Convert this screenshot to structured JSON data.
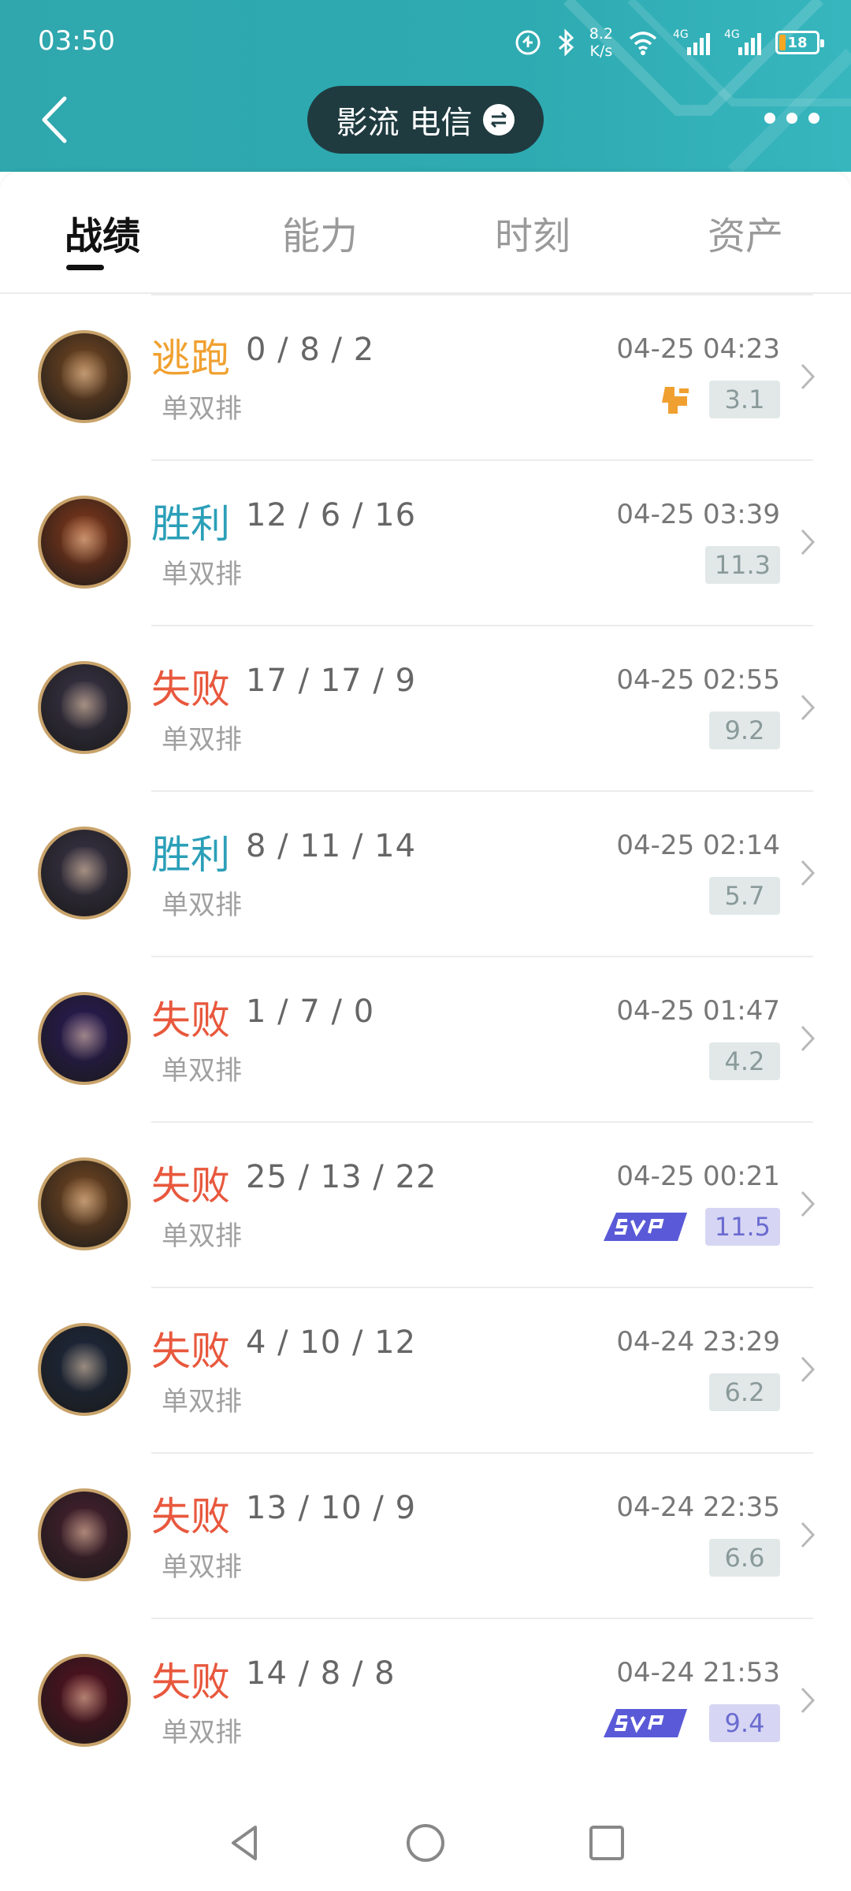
{
  "status_bar": {
    "time": "03:50",
    "net_speed_value": "8.2",
    "net_speed_unit": "K/s",
    "signal1_label": "4G",
    "signal2_label": "4G",
    "battery": "18"
  },
  "header": {
    "account_label": "影流 电信"
  },
  "tabs": [
    {
      "label": "战绩",
      "active": true
    },
    {
      "label": "能力",
      "active": false
    },
    {
      "label": "时刻",
      "active": false
    },
    {
      "label": "资产",
      "active": false
    }
  ],
  "matches": [
    {
      "result": "逃跑",
      "result_type": "flee",
      "kda": "0 / 8 / 2",
      "mode": "单双排",
      "time": "04-25 04:23",
      "score": "3.1",
      "badge": "flee-icon",
      "hero_color": "#7a4a22"
    },
    {
      "result": "胜利",
      "result_type": "win",
      "kda": "12 / 6 / 16",
      "mode": "单双排",
      "time": "04-25 03:39",
      "score": "11.3",
      "badge": "",
      "hero_color": "#8a3a1a"
    },
    {
      "result": "失败",
      "result_type": "loss",
      "kda": "17 / 17 / 9",
      "mode": "单双排",
      "time": "04-25 02:55",
      "score": "9.2",
      "badge": "",
      "hero_color": "#3a3448"
    },
    {
      "result": "胜利",
      "result_type": "win",
      "kda": "8 / 11 / 14",
      "mode": "单双排",
      "time": "04-25 02:14",
      "score": "5.7",
      "badge": "",
      "hero_color": "#3a3448"
    },
    {
      "result": "失败",
      "result_type": "loss",
      "kda": "1 / 7 / 0",
      "mode": "单双排",
      "time": "04-25 01:47",
      "score": "4.2",
      "badge": "",
      "hero_color": "#2a1a5a"
    },
    {
      "result": "失败",
      "result_type": "loss",
      "kda": "25 / 13 / 22",
      "mode": "单双排",
      "time": "04-25 00:21",
      "score": "11.5",
      "badge": "svp-badge",
      "hero_color": "#7a4a22"
    },
    {
      "result": "失败",
      "result_type": "loss",
      "kda": "4 / 10 / 12",
      "mode": "单双排",
      "time": "04-24 23:29",
      "score": "6.2",
      "badge": "",
      "hero_color": "#1e2a40"
    },
    {
      "result": "失败",
      "result_type": "loss",
      "kda": "13 / 10 / 9",
      "mode": "单双排",
      "time": "04-24 22:35",
      "score": "6.6",
      "badge": "",
      "hero_color": "#4a2030"
    },
    {
      "result": "失败",
      "result_type": "loss",
      "kda": "14 / 8 / 8",
      "mode": "单双排",
      "time": "04-24 21:53",
      "score": "9.4",
      "badge": "svp-badge",
      "hero_color": "#5a1020"
    }
  ],
  "colors": {
    "win": "#2b9fb8",
    "loss": "#e8583d",
    "flee": "#f0a030",
    "header_bg": "#2fa7ad",
    "svp": "#5a5ad8"
  }
}
